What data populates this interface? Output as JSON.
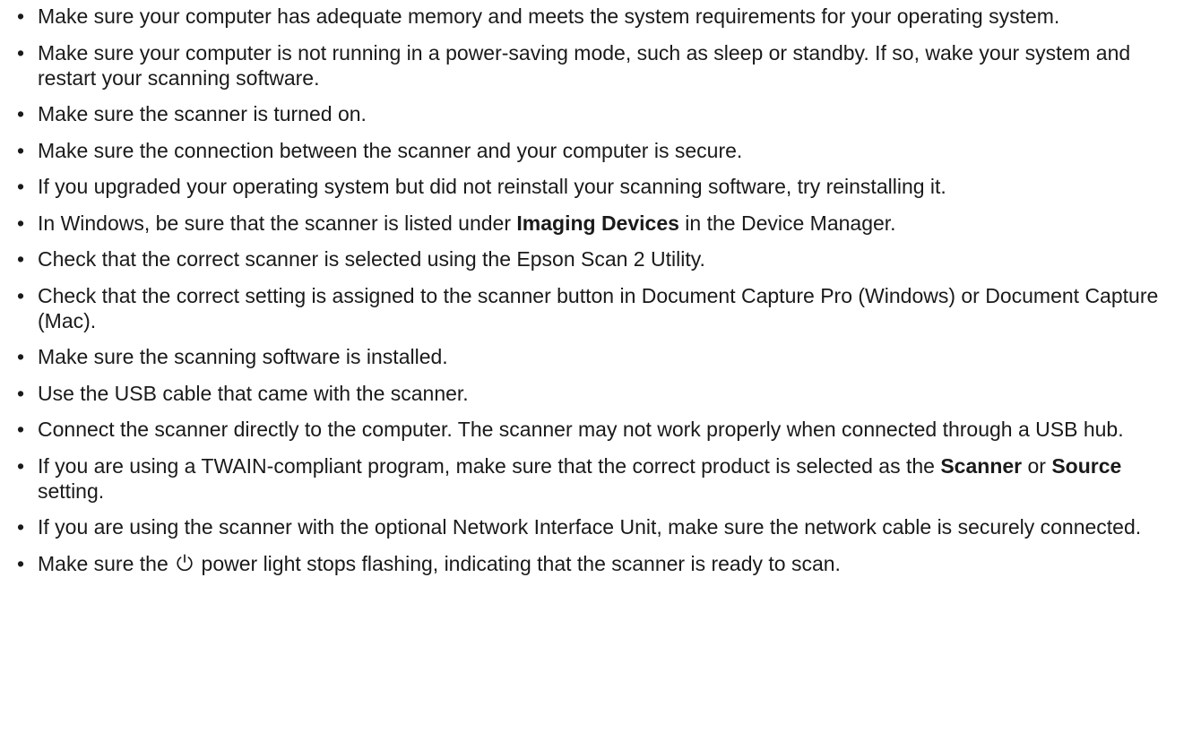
{
  "bullet_glyph": "•",
  "items": [
    {
      "segments": [
        {
          "text": "Make sure your computer has adequate memory and meets the system requirements for your operating system."
        }
      ]
    },
    {
      "segments": [
        {
          "text": "Make sure your computer is not running in a power-saving mode, such as sleep or standby. If so, wake your system and restart your scanning software."
        }
      ]
    },
    {
      "segments": [
        {
          "text": "Make sure the scanner is turned on."
        }
      ]
    },
    {
      "segments": [
        {
          "text": "Make sure the connection between the scanner and your computer is secure."
        }
      ]
    },
    {
      "segments": [
        {
          "text": "If you upgraded your operating system but did not reinstall your scanning software, try reinstalling it."
        }
      ]
    },
    {
      "segments": [
        {
          "text": "In Windows, be sure that the scanner is listed under "
        },
        {
          "text": "Imaging Devices",
          "bold": true
        },
        {
          "text": " in the Device Manager."
        }
      ]
    },
    {
      "segments": [
        {
          "text": "Check that the correct scanner is selected using the Epson Scan 2 Utility."
        }
      ]
    },
    {
      "segments": [
        {
          "text": "Check that the correct setting is assigned to the scanner button in Document Capture Pro (Windows) or Document Capture (Mac)."
        }
      ]
    },
    {
      "segments": [
        {
          "text": "Make sure the scanning software is installed."
        }
      ]
    },
    {
      "segments": [
        {
          "text": "Use the USB cable that came with the scanner."
        }
      ]
    },
    {
      "segments": [
        {
          "text": "Connect the scanner directly to the computer. The scanner may not work properly when connected through a USB hub."
        }
      ]
    },
    {
      "segments": [
        {
          "text": "If you are using a TWAIN-compliant program, make sure that the correct product is selected as the "
        },
        {
          "text": "Scanner",
          "bold": true
        },
        {
          "text": " or "
        },
        {
          "text": "Source",
          "bold": true
        },
        {
          "text": " setting."
        }
      ]
    },
    {
      "segments": [
        {
          "text": "If you are using the scanner with the optional Network Interface Unit, make sure the network cable is securely connected."
        }
      ]
    },
    {
      "segments": [
        {
          "text": "Make sure the "
        },
        {
          "icon": "power-icon"
        },
        {
          "text": " power light stops flashing, indicating that the scanner is ready to scan."
        }
      ]
    }
  ]
}
